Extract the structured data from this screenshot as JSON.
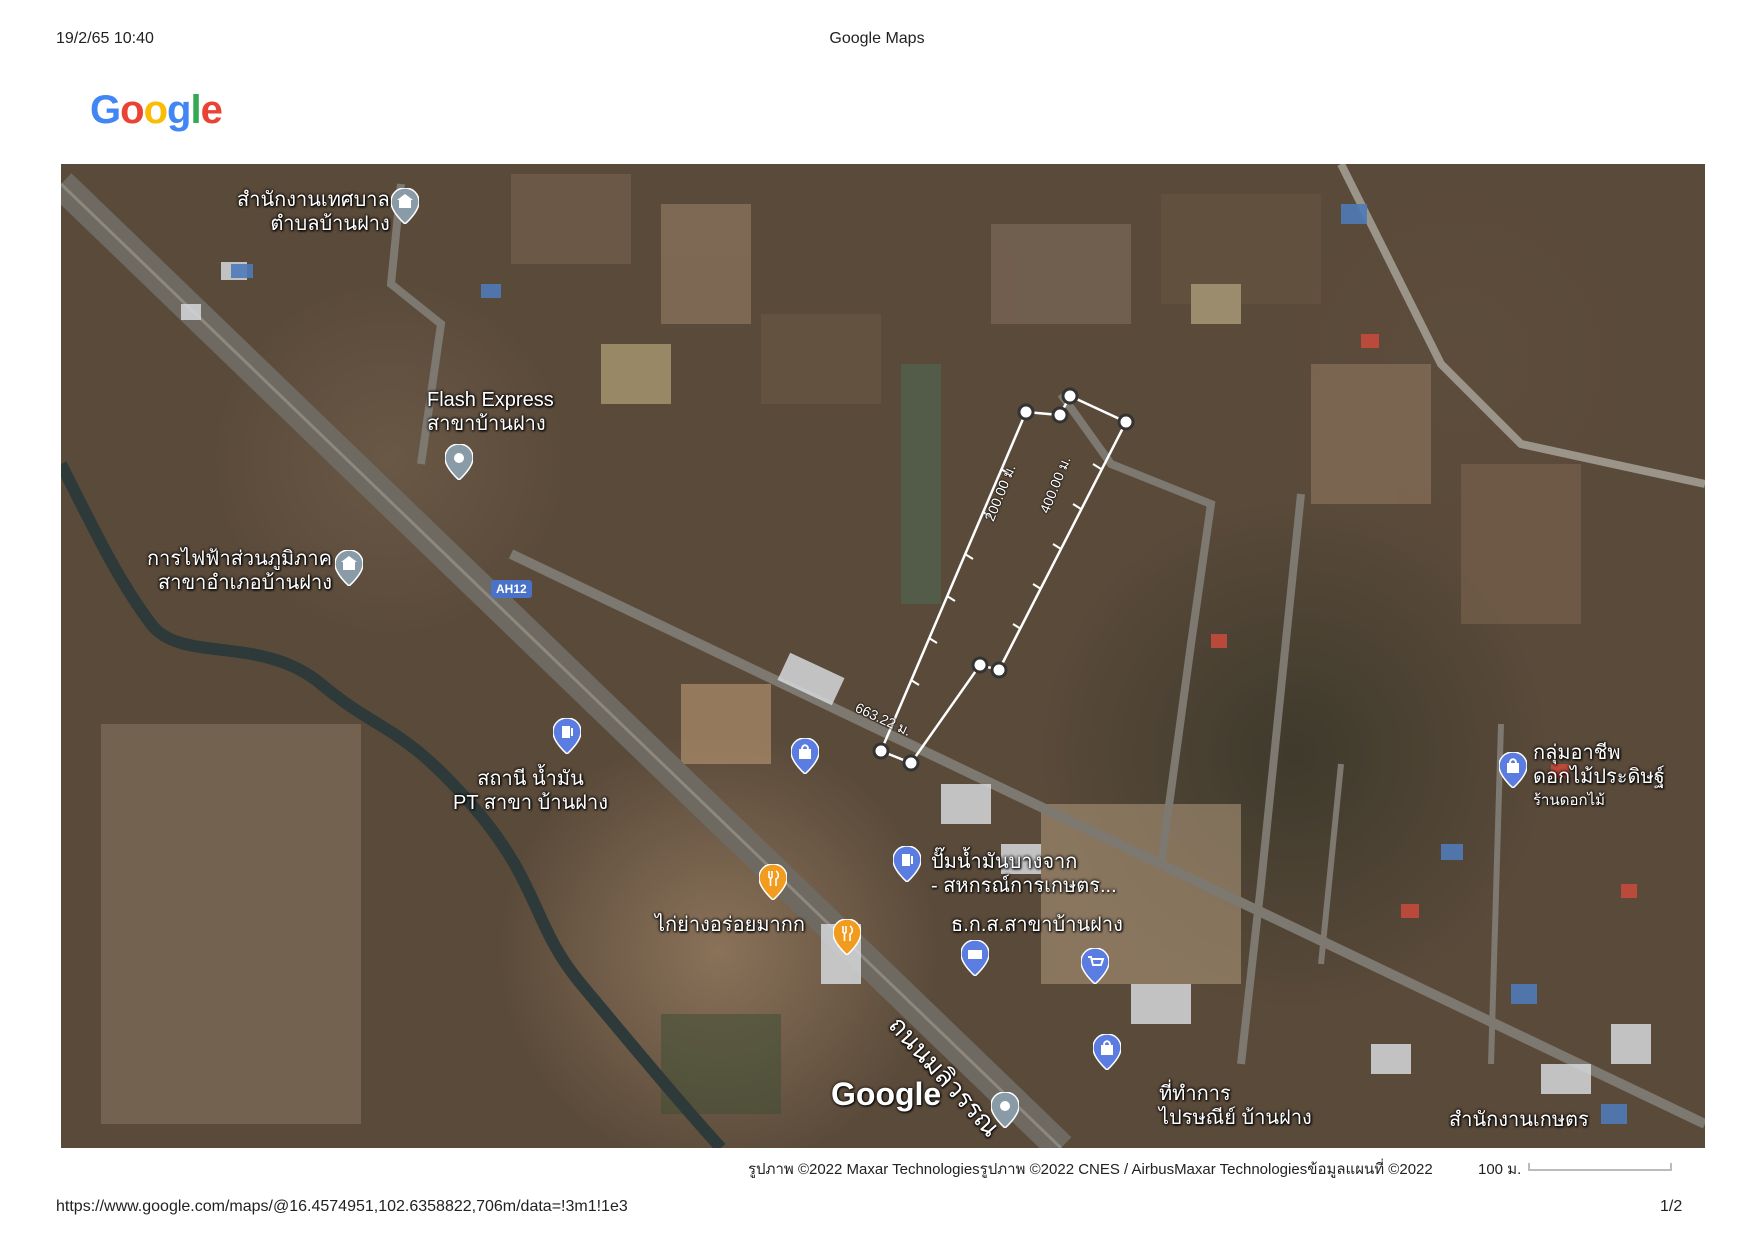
{
  "header": {
    "datetime": "19/2/65 10:40",
    "title": "Google Maps"
  },
  "logo": {
    "letters": [
      "G",
      "o",
      "o",
      "g",
      "l",
      "e"
    ],
    "colors": [
      "#4285F4",
      "#EA4335",
      "#FBBC05",
      "#4285F4",
      "#34A853",
      "#EA4335"
    ]
  },
  "map": {
    "labels": [
      {
        "text": "สำนักงานเทศบาล\nตำบลบ้านฝาง"
      },
      {
        "text": "Flash Express\nสาขาบ้านฝาง"
      },
      {
        "text": "การไฟฟ้าส่วนภูมิภาค\nสาขาอำเภอบ้านฝาง"
      },
      {
        "text": "สถานี น้ำมัน\nPT สาขา บ้านฝาง"
      },
      {
        "text": "ปั๊มน้ำมันบางจาก\n- สหกรณ์การเกษตร..."
      },
      {
        "text": "ไก่ย่างอร่อยมากก"
      },
      {
        "text": "ธ.ก.ส.สาขาบ้านฝาง"
      },
      {
        "text": "กลุ่มอาชีพ\nดอกไม้ประดิษฐ์"
      },
      {
        "text": "ร้านดอกไม้"
      },
      {
        "text": "ถนนมลิวรรณ"
      },
      {
        "text": "ที่ทำการ\nไปรษณีย์ บ้านฝาง"
      },
      {
        "text": "สำนักงานเกษตร"
      }
    ],
    "road_shield": "AH12",
    "measurements": [
      "200.00 ม.",
      "400.00 ม.",
      "663.22 ม."
    ],
    "watermark": "Google",
    "colors": {
      "food_pin": "#F29C1F",
      "poi_pin": "#5B7CE0",
      "gray_pin": "#8A9BA8"
    }
  },
  "footer": {
    "attribution": "รูปภาพ ©2022 Maxar Technologiesรูปภาพ ©2022 CNES / AirbusMaxar Technologiesข้อมูลแผนที่ ©2022",
    "scale_label": "100 ม.",
    "url": "https://www.google.com/maps/@16.4574951,102.6358822,706m/data=!3m1!1e3",
    "page": "1/2"
  }
}
